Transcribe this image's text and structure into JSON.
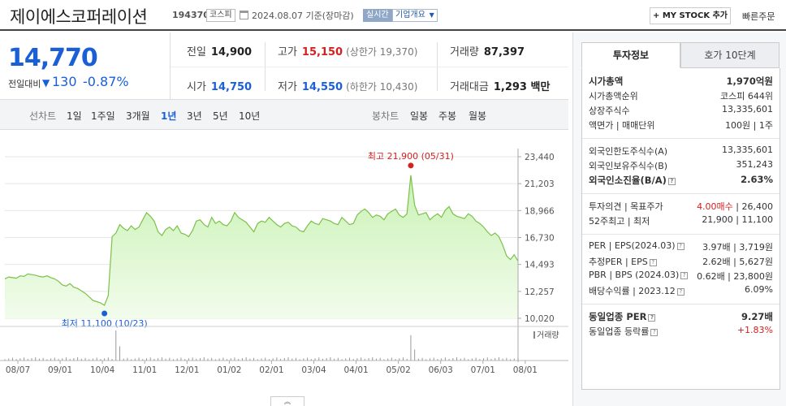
{
  "header": {
    "company_name": "제이에스코퍼레이션",
    "code": "194370",
    "market_badge": "코스피",
    "date_text": "2024.08.07  기준(장마감)",
    "realtime_badge": "실시간",
    "info_badge": "기업개요",
    "mystock_button": "+ MY STOCK 추가",
    "quick_order": "빠른주문"
  },
  "price": {
    "current": "14,770",
    "diff_label": "전일대비",
    "diff_arrow": "▼",
    "diff_value": "130",
    "diff_pct": "-0.87%"
  },
  "summary": {
    "prev_close_label": "전일",
    "prev_close": "14,900",
    "high_label": "고가",
    "high": "15,150",
    "upper_limit": "(상한가 19,370)",
    "volume_label": "거래량",
    "volume": "87,397",
    "open_label": "시가",
    "open": "14,750",
    "low_label": "저가",
    "low": "14,550",
    "lower_limit": "(하한가 10,430)",
    "amount_label": "거래대금",
    "amount": "1,293 백만"
  },
  "chart_tabs": {
    "line_label": "선차트",
    "ranges": [
      "1일",
      "1주일",
      "3개월",
      "1년",
      "3년",
      "5년",
      "10년"
    ],
    "active_range": "1년",
    "candle_label": "봉차트",
    "candles": [
      "일봉",
      "주봉",
      "월봉"
    ]
  },
  "chart_data": {
    "type": "area",
    "y_ticks": [
      "23,440",
      "21,203",
      "18,966",
      "16,730",
      "14,493",
      "12,257",
      "10,020"
    ],
    "ylim": [
      10020,
      23440
    ],
    "x_ticks": [
      "08/07",
      "09/01",
      "10/04",
      "11/01",
      "12/01",
      "01/02",
      "02/01",
      "03/04",
      "04/01",
      "05/02",
      "06/03",
      "07/01",
      "08/01"
    ],
    "high_annotation": "최고 21,900 (05/31)",
    "low_annotation": "최저 11,100 (10/23)",
    "volume_legend": "거래량",
    "series": [
      {
        "values": [
          13300,
          13450,
          13400,
          13350,
          13550,
          13500,
          13700,
          13650,
          13600,
          13500,
          13450,
          13550,
          13400,
          13300,
          13100,
          12800,
          12700,
          12900,
          12600,
          12500,
          12300,
          12100,
          11800,
          11500,
          11400,
          11300,
          11100,
          11900,
          16800,
          17100,
          17800,
          17500,
          17300,
          17700,
          17400,
          17600,
          18200,
          18800,
          18500,
          18100,
          17200,
          16900,
          17400,
          17600,
          17300,
          17700,
          17100,
          17000,
          16800,
          17300,
          18100,
          18200,
          17800,
          17600,
          18400,
          17900,
          18100,
          17800,
          17700,
          18100,
          18800,
          18400,
          18200,
          18000,
          17600,
          17200,
          17900,
          18100,
          18000,
          18400,
          18100,
          17800,
          17600,
          17900,
          18000,
          17700,
          17600,
          17300,
          17200,
          17700,
          18100,
          17900,
          17800,
          18300,
          18200,
          18100,
          17900,
          17800,
          18400,
          18100,
          17800,
          17900,
          18600,
          18900,
          19100,
          18800,
          18400,
          18600,
          18500,
          18200,
          18700,
          18900,
          19100,
          18600,
          18400,
          18700,
          21900,
          19400,
          18600,
          18700,
          18800,
          18200,
          18500,
          18700,
          18400,
          19000,
          19300,
          18700,
          18500,
          18400,
          18300,
          18700,
          18500,
          18100,
          17900,
          17600,
          17200,
          16900,
          17100,
          16800,
          16100,
          15200,
          14900,
          15300,
          14770
        ]
      }
    ],
    "volume_spikes": [
      {
        "x_index": 29,
        "value": 0.95
      },
      {
        "x_index": 30,
        "value": 0.45
      },
      {
        "x_index": 106,
        "value": 0.8
      },
      {
        "x_index": 107,
        "value": 0.35
      }
    ]
  },
  "side": {
    "tab_active": "투자정보",
    "tab_other": "호가 10단계",
    "rows": [
      {
        "l": "시가총액",
        "r": "1,970억원",
        "bold": true
      },
      {
        "l": "시가총액순위",
        "r": "코스피  644위"
      },
      {
        "l": "상장주식수",
        "r": "13,335,601"
      },
      {
        "l": "액면가 | 매매단위",
        "r": "100원 | 1주"
      },
      {
        "l": "외국인한도주식수(A)",
        "r": "13,335,601"
      },
      {
        "l": "외국인보유주식수(B)",
        "r": "351,243"
      },
      {
        "l": "외국인소진율(B/A)",
        "r": "2.63%",
        "bold": true,
        "q": true
      },
      {
        "l": "투자의견 | 목표주가",
        "r": "4.00매수 | 26,400",
        "red_prefix": "4.00매수"
      },
      {
        "l": "52주최고 | 최저",
        "r": "21,900 | 11,100"
      },
      {
        "l": "PER | EPS(2024.03)",
        "r": "3.97배 | 3,719원",
        "q": true
      },
      {
        "l": "추정PER | EPS",
        "r": "2.62배 | 5,627원",
        "q": true
      },
      {
        "l": "PBR | BPS (2024.03)",
        "r": "0.62배 | 23,800원",
        "q": true
      },
      {
        "l": "배당수익률 | 2023.12",
        "r": "6.09%",
        "q": true
      },
      {
        "l": "동일업종 PER",
        "r": "9.27배",
        "bold": true,
        "q": true
      },
      {
        "l": "동일업종 등락률",
        "r": "+1.83%",
        "q": true,
        "red": true
      }
    ]
  }
}
